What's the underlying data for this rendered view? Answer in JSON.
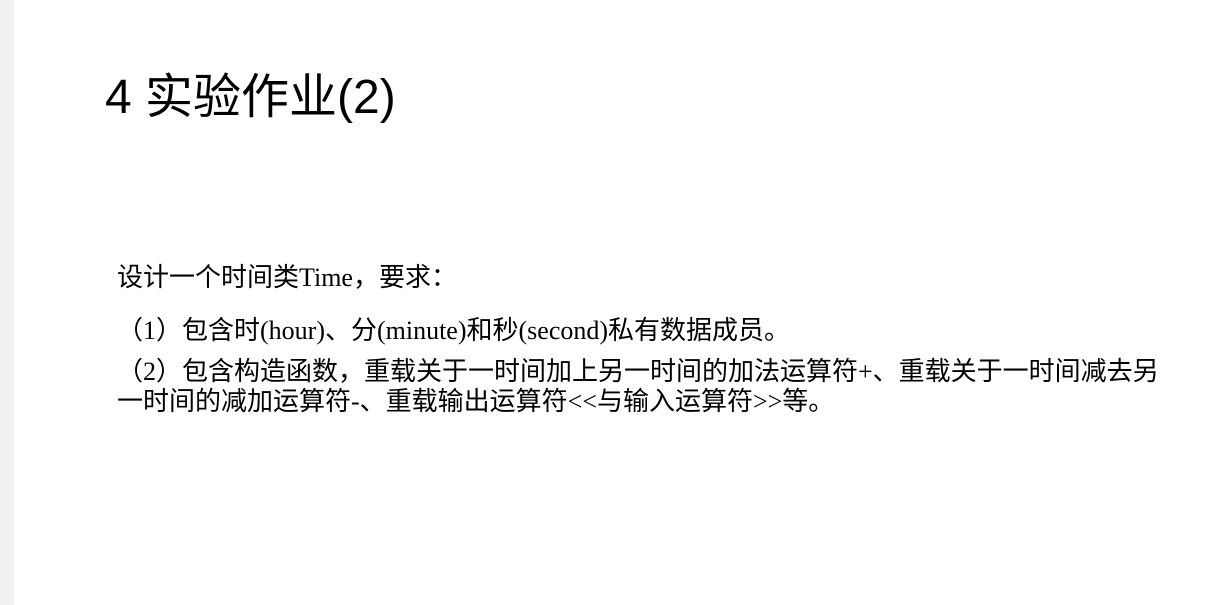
{
  "slide": {
    "title": "4 实验作业(2)",
    "paragraphs": [
      "设计一个时间类Time，要求：",
      "（1）包含时(hour)、分(minute)和秒(second)私有数据成员。",
      "（2）包含构造函数，重载关于一时间加上另一时间的加法运算符+、重载关于一时间减去另一时间的减加运算符-、重载输出运算符<<与输入运算符>>等。"
    ]
  }
}
